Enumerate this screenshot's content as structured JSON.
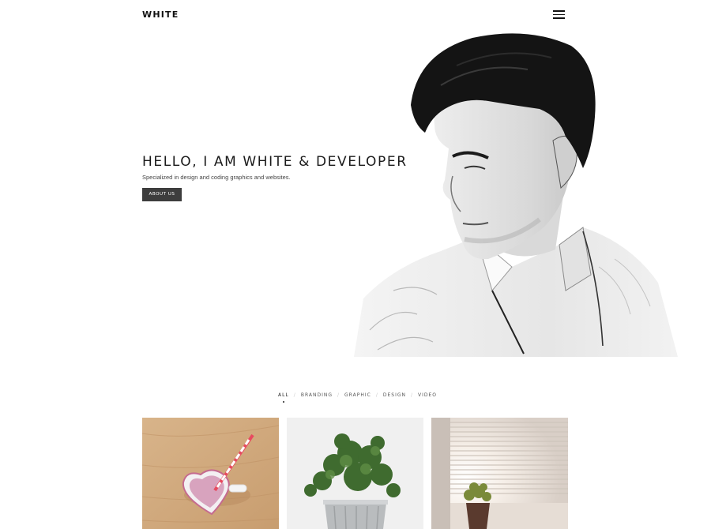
{
  "header": {
    "logo": "WHITE",
    "menu_icon": "hamburger-menu-icon"
  },
  "hero": {
    "title": "HELLO, I AM WHITE & DEVELOPER",
    "subtitle": "Specialized in design and coding graphics and websites.",
    "button_label": "ABOUT US"
  },
  "filters": {
    "items": [
      {
        "label": "ALL",
        "active": true
      },
      {
        "label": "BRANDING",
        "active": false
      },
      {
        "label": "GRAPHIC",
        "active": false
      },
      {
        "label": "DESIGN",
        "active": false
      },
      {
        "label": "VIDEO",
        "active": false
      }
    ],
    "separator": "/"
  },
  "gallery": {
    "items": [
      {
        "image": "heart-mug-with-straw"
      },
      {
        "image": "potted-plant-metal-bucket"
      },
      {
        "image": "small-plant-by-window-blinds"
      }
    ]
  },
  "colors": {
    "text": "#111111",
    "button_bg": "#3d3d3d",
    "background": "#ffffff"
  }
}
